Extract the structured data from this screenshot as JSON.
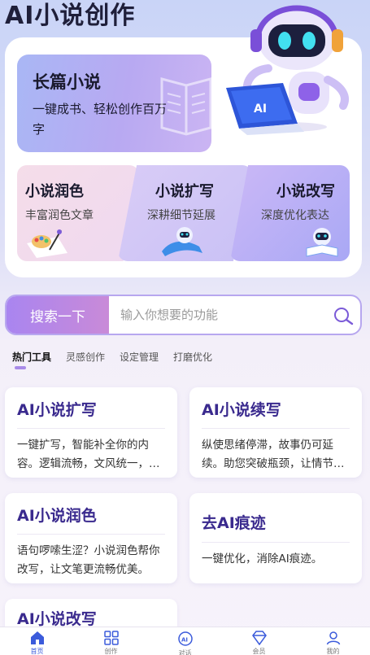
{
  "app": {
    "title": "AI小说创作"
  },
  "hero": {
    "main_card": {
      "title": "长篇小说",
      "subtitle": "一键成书、轻松创作百万字"
    },
    "features": [
      {
        "title": "小说润色",
        "subtitle": "丰富润色文章"
      },
      {
        "title": "小说扩写",
        "subtitle": "深耕细节延展"
      },
      {
        "title": "小说改写",
        "subtitle": "深度优化表达"
      }
    ]
  },
  "search": {
    "button_label": "搜索一下",
    "placeholder": "输入你想要的功能"
  },
  "tabs": [
    {
      "label": "热门工具",
      "active": true
    },
    {
      "label": "灵感创作",
      "active": false
    },
    {
      "label": "设定管理",
      "active": false
    },
    {
      "label": "打磨优化",
      "active": false
    }
  ],
  "tools": [
    {
      "title": "AI小说扩写",
      "desc": "一键扩写，智能补全你的内容。逻辑流畅，文风统一，让故事更加饱满。"
    },
    {
      "title": "AI小说续写",
      "desc": "纵使思绪停滞，故事仍可延续。助您突破瓶颈，让情节继续发展。"
    },
    {
      "title": "AI小说润色",
      "desc": "语句啰嗦生涩？小说润色帮你改写，让文笔更流畅优美。"
    },
    {
      "title": "去AI痕迹",
      "desc": "一键优化，消除AI痕迹。"
    },
    {
      "title": "AI小说改写",
      "desc": ""
    }
  ],
  "nav": [
    {
      "label": "首页",
      "icon": "home-icon",
      "active": true
    },
    {
      "label": "创作",
      "icon": "grid-icon",
      "active": false
    },
    {
      "label": "对话",
      "icon": "ai-chat-icon",
      "active": false
    },
    {
      "label": "会员",
      "icon": "diamond-icon",
      "active": false
    },
    {
      "label": "我的",
      "icon": "user-icon",
      "active": false
    }
  ],
  "colors": {
    "accent": "#a985f0",
    "title_purple": "#3a2a8e",
    "nav_active": "#3b5bdb"
  }
}
